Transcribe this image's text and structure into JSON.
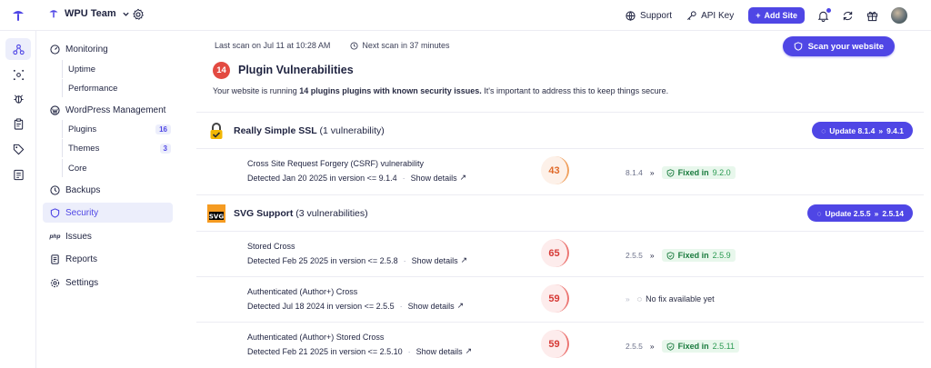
{
  "topbar": {
    "team_name": "WPU Team",
    "support_label": "Support",
    "api_key_label": "API Key",
    "add_site_label": "Add Site"
  },
  "sidebar": {
    "monitoring": "Monitoring",
    "uptime": "Uptime",
    "performance": "Performance",
    "wp_management": "WordPress Management",
    "plugins": "Plugins",
    "plugins_count": "16",
    "themes": "Themes",
    "themes_count": "3",
    "core": "Core",
    "backups": "Backups",
    "security": "Security",
    "issues": "Issues",
    "reports": "Reports",
    "settings": "Settings"
  },
  "main": {
    "last_scan": "Last scan on Jul 11 at 10:28 AM",
    "next_scan": "Next scan in 37 minutes",
    "scan_button": "Scan your website",
    "vuln_count": "14",
    "title": "Plugin Vulnerabilities",
    "desc_pre": "Your website is running ",
    "desc_bold": "14 plugins plugins with known security issues.",
    "desc_post": " It's important to address this to keep things secure.",
    "show_details": "Show details",
    "fixed_in": "Fixed in",
    "no_fix": "No fix available yet"
  },
  "plugins": [
    {
      "name": "Really Simple SSL",
      "count": "(1 vulnerability)",
      "update_from": "Update 8.1.4",
      "update_to": "9.4.1",
      "vulns": [
        {
          "title": "Cross Site Request Forgery (CSRF) vulnerability",
          "detected": "Detected Jan 20 2025 in version <= 9.1.4",
          "score": "43",
          "version": "8.1.4",
          "fix": "9.2.0"
        }
      ]
    },
    {
      "name": "SVG Support",
      "count": "(3 vulnerabilities)",
      "update_from": "Update 2.5.5",
      "update_to": "2.5.14",
      "vulns": [
        {
          "title": "Stored Cross",
          "detected": "Detected Feb 25 2025 in version <= 2.5.8",
          "score": "65",
          "version": "2.5.5",
          "fix": "2.5.9"
        },
        {
          "title": "Authenticated (Author+) Cross",
          "detected": "Detected Jul 18 2024 in version <= 2.5.5",
          "score": "59",
          "version": "",
          "fix": ""
        },
        {
          "title": "Authenticated (Author+) Stored Cross",
          "detected": "Detected Feb 21 2025 in version <= 2.5.10",
          "score": "59",
          "version": "2.5.5",
          "fix": "2.5.11"
        }
      ]
    }
  ],
  "colors": {
    "accent": "#4f46e5",
    "danger": "#e34a41",
    "success": "#1a7b3e"
  }
}
